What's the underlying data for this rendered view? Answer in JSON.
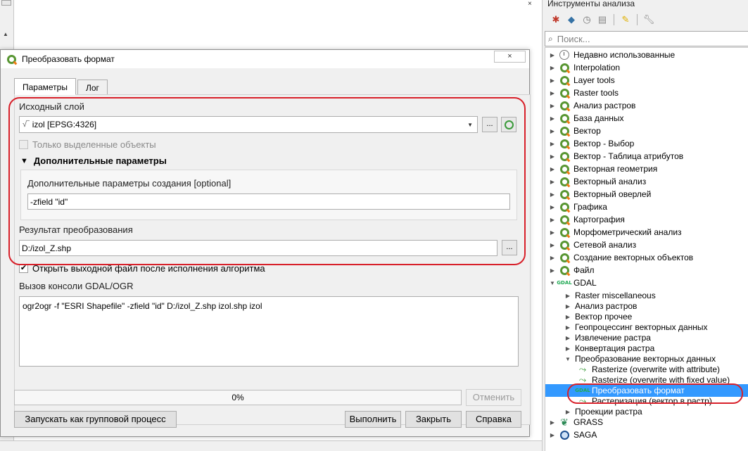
{
  "canvas": {
    "corner_label": "×"
  },
  "right_panel": {
    "title": "Инструменты анализа",
    "search_placeholder": "Поиск...",
    "tree": [
      {
        "label": "Недавно использованные",
        "icon": "clock-icon",
        "level": 0,
        "expanded": false
      },
      {
        "label": "Interpolation",
        "icon": "qgis-icon",
        "level": 0,
        "expanded": false
      },
      {
        "label": "Layer tools",
        "icon": "qgis-icon",
        "level": 0,
        "expanded": false
      },
      {
        "label": "Raster tools",
        "icon": "qgis-icon",
        "level": 0,
        "expanded": false
      },
      {
        "label": "Анализ растров",
        "icon": "qgis-icon",
        "level": 0,
        "expanded": false
      },
      {
        "label": "База данных",
        "icon": "qgis-icon",
        "level": 0,
        "expanded": false
      },
      {
        "label": "Вектор",
        "icon": "qgis-icon",
        "level": 0,
        "expanded": false
      },
      {
        "label": "Вектор - Выбор",
        "icon": "qgis-icon",
        "level": 0,
        "expanded": false
      },
      {
        "label": "Вектор - Таблица атрибутов",
        "icon": "qgis-icon",
        "level": 0,
        "expanded": false
      },
      {
        "label": "Векторная геометрия",
        "icon": "qgis-icon",
        "level": 0,
        "expanded": false
      },
      {
        "label": "Векторный анализ",
        "icon": "qgis-icon",
        "level": 0,
        "expanded": false
      },
      {
        "label": "Векторный оверлей",
        "icon": "qgis-icon",
        "level": 0,
        "expanded": false
      },
      {
        "label": "Графика",
        "icon": "qgis-icon",
        "level": 0,
        "expanded": false
      },
      {
        "label": "Картография",
        "icon": "qgis-icon",
        "level": 0,
        "expanded": false
      },
      {
        "label": "Морфометрический анализ",
        "icon": "qgis-icon",
        "level": 0,
        "expanded": false
      },
      {
        "label": "Сетевой анализ",
        "icon": "qgis-icon",
        "level": 0,
        "expanded": false
      },
      {
        "label": "Создание векторных объектов",
        "icon": "qgis-icon",
        "level": 0,
        "expanded": false
      },
      {
        "label": "Файл",
        "icon": "qgis-icon",
        "level": 0,
        "expanded": false
      },
      {
        "label": "GDAL",
        "icon": "gdal-icon",
        "level": 0,
        "expanded": true
      },
      {
        "label": "Raster miscellaneous",
        "icon": "",
        "level": 1,
        "expanded": false
      },
      {
        "label": "Анализ растров",
        "icon": "",
        "level": 1,
        "expanded": false
      },
      {
        "label": "Вектор прочее",
        "icon": "",
        "level": 1,
        "expanded": false
      },
      {
        "label": "Геопроцессинг векторных данных",
        "icon": "",
        "level": 1,
        "expanded": false
      },
      {
        "label": "Извлечение растра",
        "icon": "",
        "level": 1,
        "expanded": false
      },
      {
        "label": "Конвертация растра",
        "icon": "",
        "level": 1,
        "expanded": false
      },
      {
        "label": "Преобразование векторных данных",
        "icon": "",
        "level": 1,
        "expanded": true
      },
      {
        "label": "Rasterize (overwrite with attribute)",
        "icon": "rasterize-icon",
        "level": 2,
        "expanded": false
      },
      {
        "label": "Rasterize (overwrite with fixed value)",
        "icon": "rasterize-icon",
        "level": 2,
        "expanded": false
      },
      {
        "label": "Преобразовать формат",
        "icon": "gdal-icon",
        "level": 2,
        "expanded": false,
        "selected": true
      },
      {
        "label": "Растеризация (вектор в растр)",
        "icon": "rasterize-icon",
        "level": 2,
        "expanded": false
      },
      {
        "label": "Проекции растра",
        "icon": "",
        "level": 1,
        "expanded": false
      },
      {
        "label": "GRASS",
        "icon": "grass-icon",
        "level": 0,
        "expanded": false
      },
      {
        "label": "SAGA",
        "icon": "saga-icon",
        "level": 0,
        "expanded": false
      }
    ]
  },
  "dialog": {
    "title": "Преобразовать формат",
    "close_label": "×",
    "tabs": [
      {
        "label": "Параметры",
        "active": true
      },
      {
        "label": "Лог",
        "active": false
      }
    ],
    "input_layer_label": "Исходный слой",
    "input_layer_value": "izol [EPSG:4326]",
    "browse_label": "...",
    "selected_only_label": "Только выделенные объекты",
    "advanced_header": "Дополнительные параметры",
    "creation_options_label": "Дополнительные параметры создания [optional]",
    "creation_options_value": "-zfield \"id\"",
    "output_label": "Результат преобразования",
    "output_value": "D:/izol_Z.shp",
    "open_output_label": "Открыть выходной файл после исполнения алгоритма",
    "console_label": "Вызов консоли GDAL/OGR",
    "console_value": "ogr2ogr -f \"ESRI Shapefile\" -zfield \"id\" D:/izol_Z.shp izol.shp izol",
    "progress_text": "0%",
    "progress_value": 0,
    "cancel_label": "Отменить",
    "batch_label": "Запускать как групповой процесс",
    "run_label": "Выполнить",
    "close_button_label": "Закрыть",
    "help_label": "Справка"
  },
  "colors": {
    "highlight_red": "#d8202a",
    "selection_blue": "#3399ff",
    "qgis_green": "#589632"
  }
}
